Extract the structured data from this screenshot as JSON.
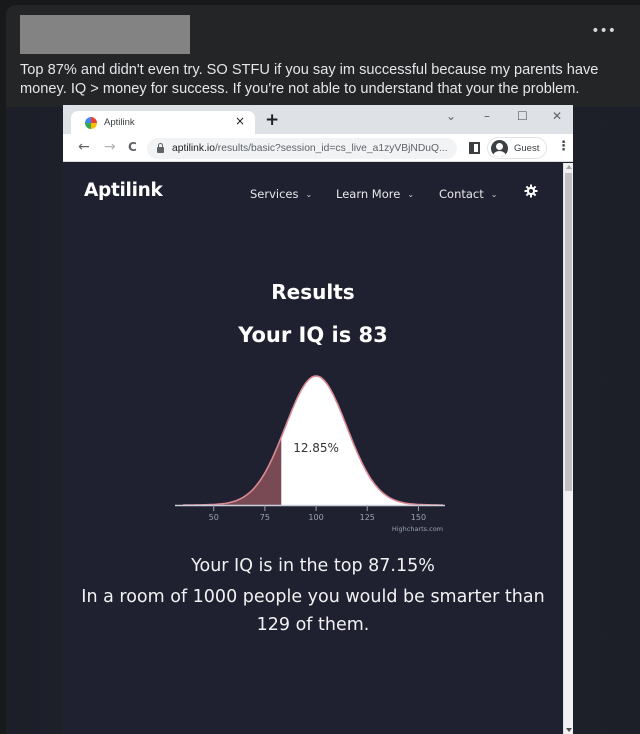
{
  "post": {
    "more_label": "•••",
    "text": "Top 87% and didn't even try. SO STFU if you say im successful because my parents have money. IQ > money for success. If you're not able to understand that your the problem."
  },
  "browser": {
    "tab_title": "Aptilink",
    "tab_close": "×",
    "new_tab": "+",
    "window_controls": {
      "tab_search": "⌄",
      "minimize": "–",
      "maximize": "☐",
      "close": "✕"
    },
    "nav": {
      "back": "←",
      "forward": "→",
      "reload": "C"
    },
    "url_host": "aptilink.io",
    "url_path": "/results/basic?session_id=cs_live_a1zyVBjNDuQ...",
    "profile_label": "Guest",
    "menu": "⋮"
  },
  "site": {
    "logo": "Aptilink",
    "nav": [
      {
        "label": "Services",
        "chevron": "⌄"
      },
      {
        "label": "Learn More",
        "chevron": "⌄"
      },
      {
        "label": "Contact",
        "chevron": "⌄"
      }
    ],
    "results_heading": "Results",
    "iq_heading": "Your IQ is 83",
    "top_percent_text": "Your IQ is in the top 87.15%",
    "room_text_line1": "In a room of 1000 people you would be smarter than",
    "room_text_line2": "129 of them."
  },
  "colors": {
    "page_bg": "#1f2130",
    "curve_fill": "#ffffff",
    "curve_stroke": "#d98a94",
    "shaded_fill": "#7a4a54",
    "axis": "#9aa3b5"
  },
  "chart_data": {
    "type": "area",
    "title": "",
    "distribution": "normal",
    "mean": 100,
    "std_dev": 15,
    "x_range": [
      35,
      162
    ],
    "xlim": [
      35,
      162
    ],
    "x_ticks": [
      50,
      75,
      100,
      125,
      150
    ],
    "shaded_region": {
      "from": 35,
      "to": 83
    },
    "shaded_label": "12.85%",
    "credit": "Highcharts.com",
    "xlabel": "",
    "ylabel": "",
    "grid": false,
    "legend": "none"
  }
}
